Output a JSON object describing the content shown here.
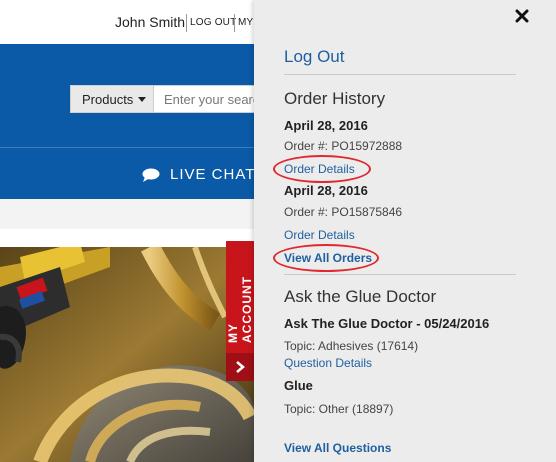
{
  "header": {
    "user_name": "John Smith",
    "logout_label": "LOG OUT",
    "my_label": "MY"
  },
  "search": {
    "category_label": "Products",
    "placeholder": "Enter your search"
  },
  "live_chat": {
    "label": "LIVE CHAT"
  },
  "my_account_tab": {
    "label": "MY ACCOUNT"
  },
  "panel": {
    "logout_label": "Log Out",
    "order_history": {
      "title": "Order History",
      "orders": [
        {
          "date": "April 28, 2016",
          "order_number": "Order #: PO15972888",
          "details_label": "Order Details"
        },
        {
          "date": "April 28, 2016",
          "order_number": "Order #: PO15875846",
          "details_label": "Order Details"
        }
      ],
      "view_all_label": "View All Orders"
    },
    "glue_doctor": {
      "title": "Ask the Glue Doctor",
      "questions": [
        {
          "title": "Ask The Glue Doctor - 05/24/2016",
          "topic": "Topic: Adhesives (17614)",
          "details_label": "Question Details"
        },
        {
          "title": "Glue",
          "topic": "Topic: Other (18897)"
        }
      ],
      "view_all_label": "View All Questions"
    }
  },
  "colors": {
    "brand_blue": "#0a5aa8",
    "accent_red": "#c8141b",
    "link_blue": "#1f5f9f",
    "highlight_ring": "#e0282e",
    "panel_bg": "#ececec"
  }
}
